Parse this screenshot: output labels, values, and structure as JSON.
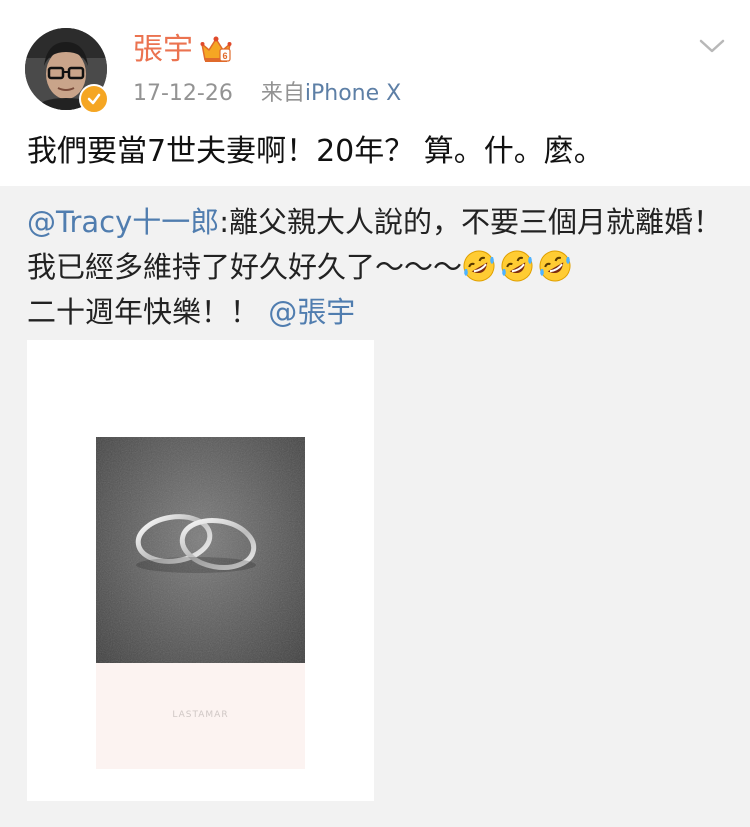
{
  "user": {
    "name": "張宇",
    "timestamp": "17-12-26",
    "source_prefix": "来自",
    "source_device": "iPhone X"
  },
  "post": {
    "text": "我們要當7世夫妻啊！20年？ 算。什。麼。"
  },
  "repost": {
    "author": "@Tracy十一郎",
    "text_part1": ":離父親大人說的，不要三個月就離婚！我已經多維持了好久好久了～～～",
    "text_part2": "二十週年快樂！！ ",
    "mention": "@張宇",
    "emoji_count": 3
  },
  "image": {
    "caption": "LASTAMAR"
  },
  "colors": {
    "name": "#eb7350",
    "link": "#507daf",
    "meta": "#939393",
    "repost_bg": "#f2f2f2",
    "verified": "#f5a623"
  },
  "icons": [
    "avatar",
    "verified-icon",
    "vip-crown-icon",
    "chevron-down-icon",
    "rofl-emoji-icon"
  ]
}
